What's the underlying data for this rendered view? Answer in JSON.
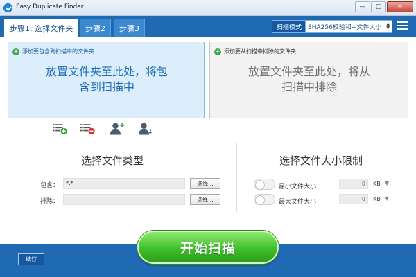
{
  "window": {
    "title": "Easy Duplicate Finder",
    "controls": {
      "minimize": "—",
      "maximize": "□",
      "close": "✕"
    }
  },
  "header": {
    "tabs": [
      {
        "label": "步骤1: 选择文件夹",
        "active": true
      },
      {
        "label": "步骤2",
        "active": false
      },
      {
        "label": "步骤3",
        "active": false
      }
    ],
    "scan_mode_label": "扫描模式",
    "scan_mode_value": "SHA256校验和+文件大小",
    "menu_icon": "hamburger-menu-icon"
  },
  "include_panel": {
    "heading": "添加要包含到扫描中的文件夹",
    "drop_text": "放置文件夹至此处，将包含到扫描中",
    "icon": "add-circle-icon"
  },
  "exclude_panel": {
    "heading": "添加要从扫描中排除的文件夹",
    "drop_text": "放置文件夹至此处，将从扫描中排除",
    "icon": "add-circle-icon"
  },
  "actions": {
    "icons": [
      "add-list-icon",
      "remove-list-icon",
      "add-user-icon",
      "user-download-icon"
    ]
  },
  "file_types": {
    "title": "选择文件类型",
    "include_label": "包含：",
    "include_value": "*.*",
    "exclude_label": "排除：",
    "exclude_value": "",
    "browse_label": "选择..."
  },
  "size_limits": {
    "title": "选择文件大小限制",
    "min_label": "最小文件大小",
    "min_value": "0",
    "max_label": "最大文件大小",
    "max_value": "0",
    "unit": "KB"
  },
  "footer": {
    "donate_label": "续订",
    "start_label": "开始扫描"
  },
  "colors": {
    "accent": "#1f6ab3",
    "start_button": "#3fbf2a",
    "include_panel_bg": "#dceefc"
  }
}
